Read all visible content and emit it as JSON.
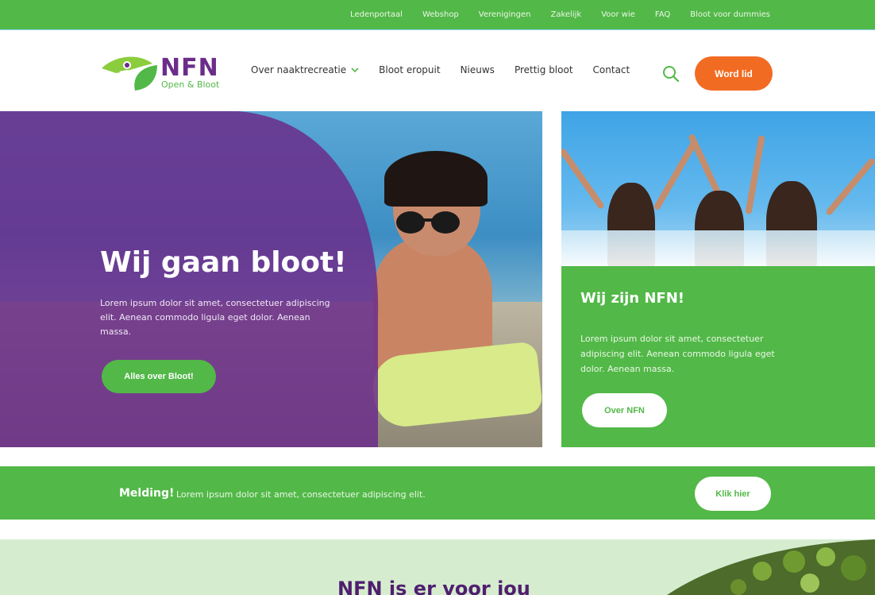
{
  "topbar": {
    "links": [
      "Ledenportaal",
      "Webshop",
      "Verenigingen",
      "Zakelijk",
      "Voor wie",
      "FAQ",
      "Bloot voor dummies"
    ]
  },
  "logo": {
    "name": "NFN",
    "tagline": "Open & Bloot"
  },
  "nav": {
    "items": [
      "Over naaktrecreatie",
      "Bloot eropuit",
      "Nieuws",
      "Prettig bloot",
      "Contact"
    ],
    "cta": "Word lid"
  },
  "hero": {
    "title": "Wij gaan bloot!",
    "text": "Lorem ipsum dolor sit amet, consectetuer adipiscing elit. Aenean commodo ligula eget dolor. Aenean massa.",
    "button": "Alles over Bloot!"
  },
  "card": {
    "title": "Wij zijn NFN!",
    "text": "Lorem ipsum dolor sit amet, consectetuer adipiscing elit. Aenean commodo ligula eget dolor. Aenean massa.",
    "button": "Over NFN"
  },
  "alert": {
    "label": "Melding!",
    "message": "Lorem ipsum dolor sit amet, consectetuer adipiscing elit.",
    "button": "Klik hier"
  },
  "section": {
    "title": "NFN is er voor jou"
  },
  "colors": {
    "green": "#52b848",
    "purple": "#6b2d8a",
    "orange": "#f26b22",
    "mint": "#d6eccf"
  }
}
